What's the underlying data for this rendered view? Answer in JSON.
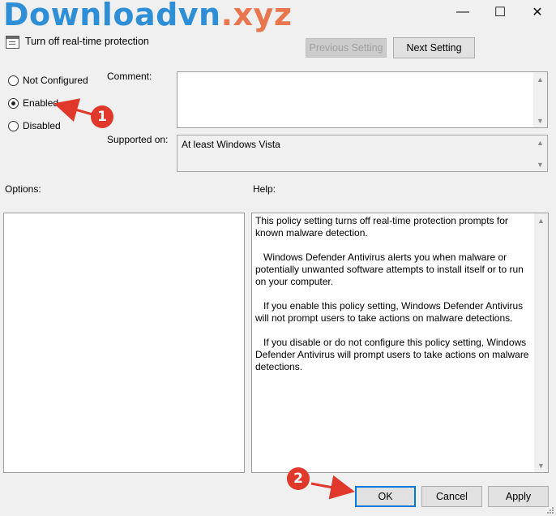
{
  "watermark": {
    "part1": "Downloadvn",
    "part2": ".xyz"
  },
  "window": {
    "minimize": "—",
    "maximize": "☐",
    "close": "✕"
  },
  "header": {
    "title": "Turn off real-time protection",
    "previous_setting": "Previous Setting",
    "next_setting": "Next Setting"
  },
  "state": {
    "options": [
      "Not Configured",
      "Enabled",
      "Disabled"
    ],
    "selected": "Enabled"
  },
  "comment": {
    "label": "Comment:",
    "value": ""
  },
  "supported": {
    "label": "Supported on:",
    "value": "At least Windows Vista"
  },
  "options_panel": {
    "label": "Options:"
  },
  "help_panel": {
    "label": "Help:",
    "paragraphs": [
      "This policy setting turns off real-time protection prompts for known malware detection.",
      "Windows Defender Antivirus alerts you when malware or potentially unwanted software attempts to install itself or to run on your computer.",
      "If you enable this policy setting, Windows Defender Antivirus will not prompt users to take actions on malware detections.",
      "If you disable or do not configure this policy setting, Windows Defender Antivirus will prompt users to take actions on malware detections."
    ]
  },
  "footer": {
    "ok": "OK",
    "cancel": "Cancel",
    "apply": "Apply"
  },
  "annotations": {
    "step1": "1",
    "step2": "2",
    "color": "#e0392b"
  }
}
